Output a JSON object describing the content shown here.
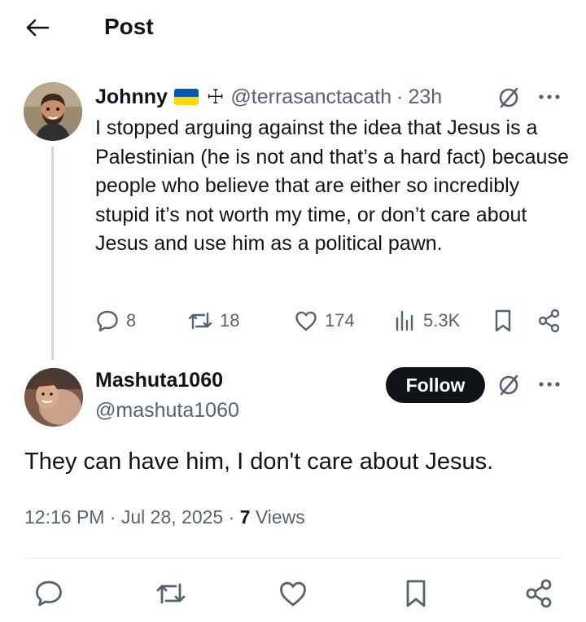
{
  "header": {
    "title": "Post"
  },
  "parent_tweet": {
    "author_name": "Johnny",
    "cross_symbol": "☩",
    "handle": "@terrasanctacath",
    "separator": "·",
    "time": "23h",
    "text": "I stopped arguing against the idea that Jesus is a Palestinian (he is not and that’s a hard fact) because people who believe that are either so incredibly stupid it’s not worth my time, or don’t care about Jesus and use him as a political pawn.",
    "replies": "8",
    "reposts": "18",
    "likes": "174",
    "views": "5.3K"
  },
  "reply_tweet": {
    "author_name": "Mashuta1060",
    "handle": "@mashuta1060",
    "follow_label": "Follow",
    "text": "They can have him, I don't care about Jesus.",
    "timestamp": "12:16 PM · Jul 28, 2025 · ",
    "views_count": "7",
    "views_label": " Views"
  },
  "colors": {
    "text_primary": "#0f1419",
    "text_secondary": "#536471",
    "follow_bg": "#0f1419",
    "thread_line": "#cfd9de",
    "flag_blue": "#0057b7",
    "flag_yellow": "#ffd700"
  }
}
